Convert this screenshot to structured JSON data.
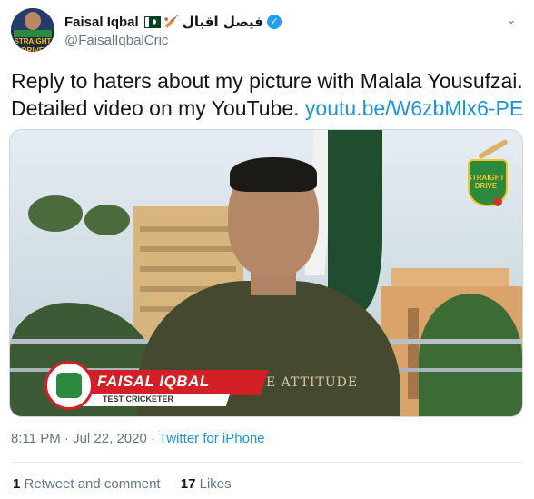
{
  "author": {
    "display_name": "Faisal Iqbal",
    "urdu_name": "فیصل اقبال",
    "handle": "@FaisalIqbalCric",
    "avatar_text": "STRAIGHT DRIVE"
  },
  "tweet": {
    "text_line1": "Reply to haters about my picture with Malala Yousufzai.",
    "text_line2": "Detailed video on my YouTube.",
    "link": "youtu.be/W6zbMlx6-PE"
  },
  "media": {
    "logo_text": "STRAIGHT DRIVE",
    "overlay_name": "FAISAL IQBAL",
    "overlay_title": "TEST CRICKETER",
    "shirt_text": "E ATTITUDE"
  },
  "meta": {
    "time": "8:11 PM",
    "separator": "·",
    "date": "Jul 22, 2020",
    "separator2": "·",
    "source": "Twitter for iPhone"
  },
  "stats": {
    "retweets_count": "1",
    "retweets_label": "Retweet and comment",
    "likes_count": "17",
    "likes_label": "Likes"
  },
  "icons": {
    "verified": "verified-badge-icon",
    "flag": "pakistan-flag-icon",
    "bat": "cricket-bat-icon",
    "menu": "chevron-down-icon"
  },
  "colors": {
    "link": "#1b95e0",
    "verified": "#1da1f2",
    "muted": "#657786",
    "overlay_red": "#d31f26"
  }
}
